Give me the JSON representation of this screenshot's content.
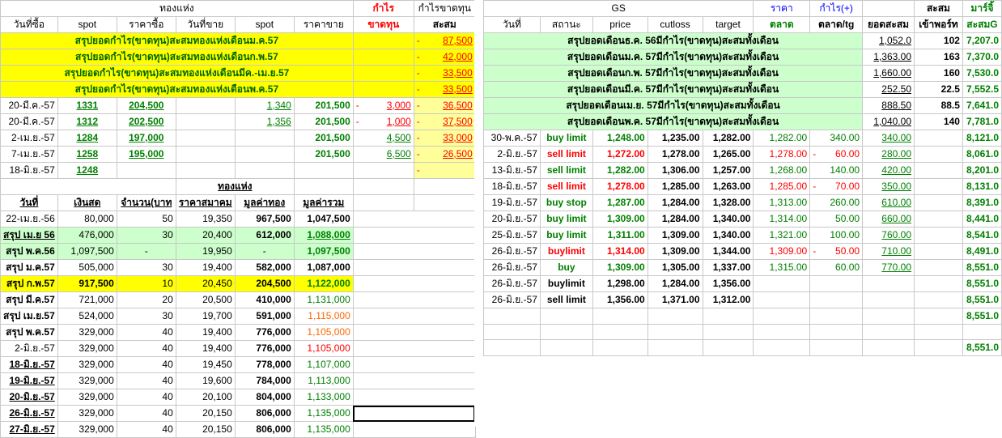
{
  "left": {
    "group_header": {
      "gold_bar": "ทองแห่ง",
      "profit": "กำไร",
      "profit_loss_acc": "กำไรขาดทุน"
    },
    "headers": [
      "วันที่ซื้อ",
      "spot",
      "ราคาซื้อ",
      "วันที่ขาย",
      "spot",
      "ราคาขาย",
      "ขาดทุน",
      "สะสม"
    ],
    "summary_rows": [
      {
        "label": "สรุปยอดกำไร(ขาดทุน)สะสมทองแห่งเดือนม.ค.57",
        "acc": "87,500"
      },
      {
        "label": "สรุปยอดกำไร(ขาดทุน)สะสมทองแห่งเดือนก.พ.57",
        "acc": "42,000"
      },
      {
        "label": "สรุปยอดกำไร(ขาดทุน)สะสมทองแห่งเดือนมีค.-เม.ย.57",
        "acc": "33,500"
      },
      {
        "label": "สรุปยอดกำไร(ขาดทุน)สะสมทองแห่งเดือนพ.ค.57",
        "acc": "33,500"
      }
    ],
    "trades": [
      {
        "buy_date": "20-มี.ค.-57",
        "spot": "1331",
        "buy_price": "204,500",
        "sell_date": "",
        "spot2": "1,340",
        "sell_price": "201,500",
        "pl": "3,000",
        "pl_neg": true,
        "acc": "36,500"
      },
      {
        "buy_date": "20-มี.ค.-57",
        "spot": "1312",
        "buy_price": "202,500",
        "sell_date": "",
        "spot2": "1,356",
        "sell_price": "201,500",
        "pl": "1,000",
        "pl_neg": true,
        "acc": "37,500"
      },
      {
        "buy_date": "2-เม.ย.-57",
        "spot": "1284",
        "buy_price": "197,000",
        "sell_date": "",
        "spot2": "",
        "sell_price": "201,500",
        "pl": "4,500",
        "pl_neg": false,
        "acc": "33,000"
      },
      {
        "buy_date": "7-เม.ย.-57",
        "spot": "1258",
        "buy_price": "195,000",
        "sell_date": "",
        "spot2": "",
        "sell_price": "201,500",
        "pl": "6,500",
        "pl_neg": false,
        "acc": "26,500"
      },
      {
        "buy_date": "18-มิ.ย.-57",
        "spot": "1248",
        "buy_price": "",
        "sell_date": "",
        "spot2": "",
        "sell_price": "",
        "pl": "",
        "pl_neg": false,
        "acc": ""
      }
    ],
    "section_title": "ทองแห่ง",
    "headers2": [
      "วันที่",
      "เงินสด",
      "จำนวน(บาท",
      "ราคาสมาคม",
      "มูลค่าทอง",
      "มูลค่ารวม"
    ],
    "holdings": [
      {
        "date": "22-เม.ย.-56",
        "cash": "80,000",
        "qty": "50",
        "price": "19,350",
        "gold_val": "967,500",
        "total": "1,047,500",
        "style": "plain"
      },
      {
        "date": "สรุป เม.ย 56",
        "cash": "476,000",
        "qty": "30",
        "price": "20,400",
        "gold_val": "612,000",
        "total": "1,088,000",
        "style": "green"
      },
      {
        "date": "สรุป พ.ค.56",
        "cash": "1,097,500",
        "qty": "-",
        "price": "19,950",
        "gold_val": "-",
        "total": "1,097,500",
        "style": "lgreen"
      },
      {
        "date": "สรุป ม.ค.57",
        "cash": "505,000",
        "qty": "30",
        "price": "19,400",
        "gold_val": "582,000",
        "total": "1,087,000",
        "style": "bold"
      },
      {
        "date": "สรุป ก.พ.57",
        "cash": "917,500",
        "qty": "10",
        "price": "20,450",
        "gold_val": "204,500",
        "total": "1,122,000",
        "style": "yellow"
      },
      {
        "date": "สรุป มี.ค.57",
        "cash": "721,000",
        "qty": "20",
        "price": "20,500",
        "gold_val": "410,000",
        "total": "1,131,000",
        "style": "mar"
      },
      {
        "date": "สรุป เม.ย.57",
        "cash": "524,000",
        "qty": "30",
        "price": "19,700",
        "gold_val": "591,000",
        "total": "1,115,000",
        "style": "apr"
      },
      {
        "date": "สรุป พ.ค.57",
        "cash": "329,000",
        "qty": "40",
        "price": "19,400",
        "gold_val": "776,000",
        "total": "1,105,000",
        "style": "may"
      },
      {
        "date": "2-มิ.ย.-57",
        "cash": "329,000",
        "qty": "40",
        "price": "19,400",
        "gold_val": "776,000",
        "total": "1,105,000",
        "style": "red"
      },
      {
        "date": "18-มิ.ย.-57",
        "cash": "329,000",
        "qty": "40",
        "price": "19,450",
        "gold_val": "778,000",
        "total": "1,107,000",
        "style": "green"
      },
      {
        "date": "19-มิ.ย.-57",
        "cash": "329,000",
        "qty": "40",
        "price": "19,600",
        "gold_val": "784,000",
        "total": "1,113,000",
        "style": "green"
      },
      {
        "date": "20-มิ.ย.-57",
        "cash": "329,000",
        "qty": "40",
        "price": "20,100",
        "gold_val": "804,000",
        "total": "1,133,000",
        "style": "green"
      },
      {
        "date": "26-มิ.ย.-57",
        "cash": "329,000",
        "qty": "40",
        "price": "20,150",
        "gold_val": "806,000",
        "total": "1,135,000",
        "style": "green"
      },
      {
        "date": "27-มิ.ย.-57",
        "cash": "329,000",
        "qty": "40",
        "price": "20,150",
        "gold_val": "806,000",
        "total": "1,135,000",
        "style": "green"
      }
    ]
  },
  "right": {
    "group_header": {
      "gs": "GS",
      "price": "ราคา",
      "profit": "กำไร(+)",
      "acc": "สะสม",
      "margin": "มาร์จิ้"
    },
    "headers": [
      "วันที่",
      "สถานะ",
      "price",
      "cutloss",
      "target",
      "ตลาด",
      "ตลาด/tg",
      "ยอดสะสม",
      "เข้าพอร์ท",
      "สะสมG"
    ],
    "summary_rows": [
      {
        "label": "สรุปยอดเดือนธ.ค. 56มีกำไร(ขาดทุน)สะสมทั้งเดือน",
        "acc": "1,052.0",
        "port": "102",
        "margin": "7,207.0"
      },
      {
        "label": "สรุปยอดเดือนม.ค. 57มีกำไร(ขาดทุน)สะสมทั้งเดือน",
        "acc": "1,363.00",
        "port": "163",
        "margin": "7,370.0"
      },
      {
        "label": "สรุปยอดเดือนก.พ. 57มีกำไร(ขาดทุน)สะสมทั้งเดือน",
        "acc": "1,660.00",
        "port": "160",
        "margin": "7,530.0"
      },
      {
        "label": "สรุปยอดเดือนมี.ค. 57มีกำไร(ขาดทุน)สะสมทั้งเดือน",
        "acc": "252.50",
        "port": "22.5",
        "margin": "7,552.5"
      },
      {
        "label": "สรุปยอดเดือนเม.ย. 57มีกำไร(ขาดทุน)สะสมทั้งเดือน",
        "acc": "888.50",
        "port": "88.5",
        "margin": "7,641.0"
      },
      {
        "label": "สรุปยอดเดือนพ.ค. 57มีกำไร(ขาดทุน)สะสมทั้งเดือน",
        "acc": "1,040.00",
        "port": "140",
        "margin": "7,781.0"
      }
    ],
    "trades": [
      {
        "date": "30-พ.ค.-57",
        "status": "buy limit",
        "status_color": "green",
        "price": "1,248.00",
        "cutloss": "1,235.00",
        "target": "1,282.00",
        "market": "1,282.00",
        "market_color": "green",
        "pl": "340.00",
        "pl_neg": false,
        "acc": "340.00",
        "margin": "8,121.0"
      },
      {
        "date": "2-มิ.ย.-57",
        "status": "sell limit",
        "status_color": "red",
        "price": "1,272.00",
        "cutloss": "1,278.00",
        "target": "1,265.00",
        "market": "1,278.00",
        "market_color": "red",
        "pl": "60.00",
        "pl_neg": true,
        "acc": "280.00",
        "margin": "8,061.0"
      },
      {
        "date": "13-มิ.ย.-57",
        "status": "sell limit",
        "status_color": "green",
        "price": "1,282.00",
        "cutloss": "1,306.00",
        "target": "1,257.00",
        "market": "1,268.00",
        "market_color": "green",
        "pl": "140.00",
        "pl_neg": false,
        "acc": "420.00",
        "margin": "8,201.0"
      },
      {
        "date": "18-มิ.ย.-57",
        "status": "sell limit",
        "status_color": "red",
        "price": "1,278.00",
        "cutloss": "1,285.00",
        "target": "1,263.00",
        "market": "1,285.00",
        "market_color": "red",
        "pl": "70.00",
        "pl_neg": true,
        "acc": "350.00",
        "margin": "8,131.0"
      },
      {
        "date": "19-มิ.ย.-57",
        "status": "buy stop",
        "status_color": "green",
        "price": "1,287.00",
        "cutloss": "1,284.00",
        "target": "1,328.00",
        "market": "1,313.00",
        "market_color": "green",
        "pl": "260.00",
        "pl_neg": false,
        "acc": "610.00",
        "margin": "8,391.0"
      },
      {
        "date": "20-มิ.ย.-57",
        "status": "buy limit",
        "status_color": "green",
        "price": "1,309.00",
        "cutloss": "1,284.00",
        "target": "1,340.00",
        "market": "1,314.00",
        "market_color": "green",
        "pl": "50.00",
        "pl_neg": false,
        "acc": "660.00",
        "margin": "8,441.0"
      },
      {
        "date": "25-มิ.ย.-57",
        "status": "buy limit",
        "status_color": "green",
        "price": "1,311.00",
        "cutloss": "1,309.00",
        "target": "1,340.00",
        "market": "1,321.00",
        "market_color": "green",
        "pl": "100.00",
        "pl_neg": false,
        "acc": "760.00",
        "margin": "8,541.0"
      },
      {
        "date": "26-มิ.ย.-57",
        "status": "buylimit",
        "status_color": "red",
        "price": "1,314.00",
        "cutloss": "1,309.00",
        "target": "1,344.00",
        "market": "1,309.00",
        "market_color": "red",
        "pl": "50.00",
        "pl_neg": true,
        "acc": "710.00",
        "margin": "8,491.0"
      },
      {
        "date": "26-มิ.ย.-57",
        "status": "buy",
        "status_color": "green",
        "price": "1,309.00",
        "cutloss": "1,305.00",
        "target": "1,337.00",
        "market": "1,315.00",
        "market_color": "green",
        "pl": "60.00",
        "pl_neg": false,
        "acc": "770.00",
        "margin": "8,551.0"
      },
      {
        "date": "26-มิ.ย.-57",
        "status": "buylimit",
        "status_color": "black",
        "price": "1,298.00",
        "cutloss": "1,284.00",
        "target": "1,356.00",
        "market": "",
        "market_color": "black",
        "pl": "",
        "pl_neg": false,
        "acc": "",
        "margin": "8,551.0"
      },
      {
        "date": "26-มิ.ย.-57",
        "status": "sell limit",
        "status_color": "black",
        "price": "1,356.00",
        "cutloss": "1,371.00",
        "target": "1,312.00",
        "market": "",
        "market_color": "black",
        "pl": "",
        "pl_neg": false,
        "acc": "",
        "margin": "8,551.0"
      },
      {
        "date": "",
        "status": "",
        "status_color": "black",
        "price": "",
        "cutloss": "",
        "target": "",
        "market": "",
        "market_color": "black",
        "pl": "",
        "pl_neg": false,
        "acc": "",
        "margin": "8,551.0"
      },
      {
        "date": "",
        "status": "",
        "status_color": "black",
        "price": "",
        "cutloss": "",
        "target": "",
        "market": "",
        "market_color": "black",
        "pl": "",
        "pl_neg": false,
        "acc": "",
        "margin": ""
      },
      {
        "date": "",
        "status": "",
        "status_color": "black",
        "price": "",
        "cutloss": "",
        "target": "",
        "market": "",
        "market_color": "black",
        "pl": "",
        "pl_neg": false,
        "acc": "",
        "margin": "8,551.0"
      }
    ]
  },
  "colors": {
    "yellow": "#ffff00",
    "light_yellow": "#ffff99",
    "light_green": "#ccffcc",
    "green": "#008000",
    "red": "#ff0000",
    "orange": "#ff6600"
  }
}
